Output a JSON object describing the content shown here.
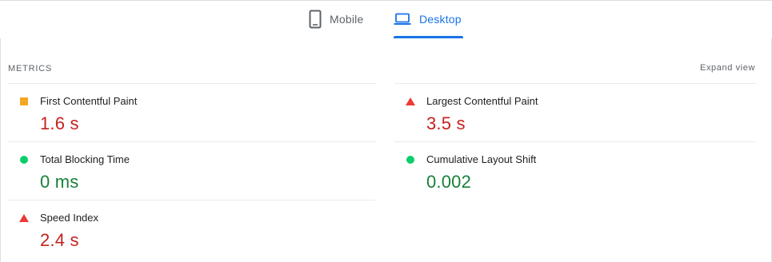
{
  "tabs": {
    "mobile_label": "Mobile",
    "desktop_label": "Desktop",
    "active": "Desktop"
  },
  "header": {
    "metrics_title": "METRICS",
    "expand_label": "Expand view"
  },
  "metrics": [
    {
      "label": "First Contentful Paint",
      "value": "1.6 s",
      "status": "average",
      "indicator": "square-icon"
    },
    {
      "label": "Largest Contentful Paint",
      "value": "3.5 s",
      "status": "fail",
      "indicator": "triangle-icon"
    },
    {
      "label": "Total Blocking Time",
      "value": "0 ms",
      "status": "pass",
      "indicator": "circle-icon"
    },
    {
      "label": "Cumulative Layout Shift",
      "value": "0.002",
      "status": "pass",
      "indicator": "circle-icon"
    },
    {
      "label": "Speed Index",
      "value": "2.4 s",
      "status": "fail",
      "indicator": "triangle-icon"
    }
  ],
  "colors": {
    "accent": "#1a73e8",
    "fail": "#c5221f",
    "pass": "#188038",
    "average": "#f5a623"
  }
}
